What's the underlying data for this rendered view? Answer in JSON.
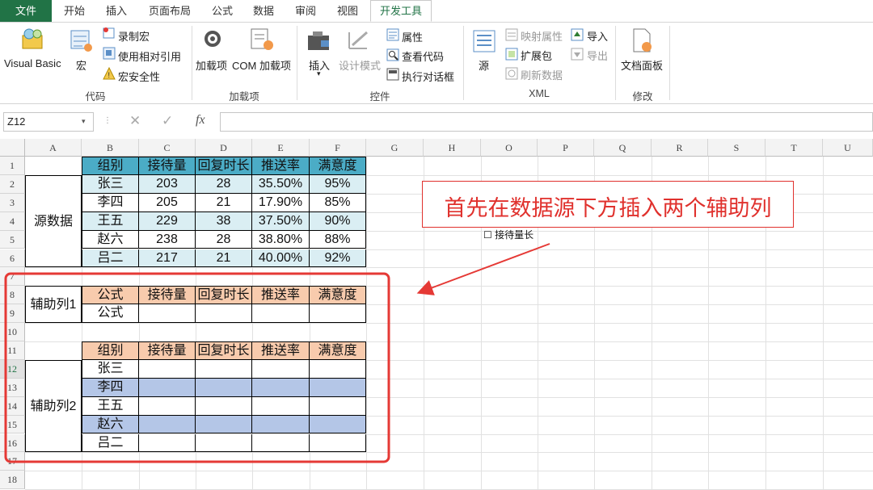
{
  "tabs": [
    "文件",
    "开始",
    "插入",
    "页面布局",
    "公式",
    "数据",
    "审阅",
    "视图",
    "开发工具"
  ],
  "ribbon": {
    "code": {
      "visual_basic": "Visual Basic",
      "macro": "宏",
      "record_macro": "录制宏",
      "relative_ref": "使用相对引用",
      "macro_security": "宏安全性",
      "label": "代码"
    },
    "addins": {
      "addins": "加载项",
      "com_addins": "COM 加载项",
      "label": "加载项"
    },
    "controls": {
      "insert": "插入",
      "design_mode": "设计模式",
      "properties": "属性",
      "view_code": "查看代码",
      "run_dialog": "执行对话框",
      "label": "控件"
    },
    "xml": {
      "source": "源",
      "map_properties": "映射属性",
      "expansion_packs": "扩展包",
      "refresh_data": "刷新数据",
      "import": "导入",
      "export": "导出",
      "label": "XML"
    },
    "modify": {
      "document_panel": "文档面板",
      "label": "修改"
    }
  },
  "formula_bar": {
    "name_box": "Z12",
    "cancel": "✕",
    "enter": "✓",
    "fx": "fx",
    "value": ""
  },
  "columns": [
    "A",
    "B",
    "C",
    "D",
    "E",
    "F",
    "G",
    "H",
    "O",
    "P",
    "Q",
    "R",
    "S",
    "T",
    "U"
  ],
  "rows": [
    "1",
    "2",
    "3",
    "4",
    "5",
    "6",
    "7",
    "8",
    "9",
    "10",
    "11",
    "12",
    "13",
    "14",
    "15",
    "16",
    "17",
    "18"
  ],
  "source_table": {
    "label": "源数据",
    "headers": [
      "组别",
      "接待量",
      "回复时长",
      "推送率",
      "满意度"
    ],
    "data": [
      [
        "张三",
        "203",
        "28",
        "35.50%",
        "95%"
      ],
      [
        "李四",
        "205",
        "21",
        "17.90%",
        "85%"
      ],
      [
        "王五",
        "229",
        "38",
        "37.50%",
        "90%"
      ],
      [
        "赵六",
        "238",
        "28",
        "38.80%",
        "88%"
      ],
      [
        "吕二",
        "217",
        "21",
        "40.00%",
        "92%"
      ]
    ]
  },
  "helper1": {
    "label": "辅助列1",
    "headers": [
      "公式",
      "接待量",
      "回复时长",
      "推送率",
      "满意度"
    ],
    "row": [
      "公式",
      "",
      "",
      "",
      ""
    ]
  },
  "helper2": {
    "label": "辅助列2",
    "headers": [
      "组别",
      "接待量",
      "回复时长",
      "推送率",
      "满意度"
    ],
    "names": [
      "张三",
      "李四",
      "王五",
      "赵六",
      "吕二"
    ]
  },
  "annotation": {
    "text": "首先在数据源下方插入两个辅助列",
    "color": "#e0312d"
  },
  "stray_label": "☐ 接待量长",
  "colors": {
    "teal": "#4bacc6",
    "light_teal": "#daeef3",
    "orange": "#f8cbad",
    "blue": "#b4c6e7",
    "excel_green": "#217346",
    "highlight": "#e53935"
  }
}
